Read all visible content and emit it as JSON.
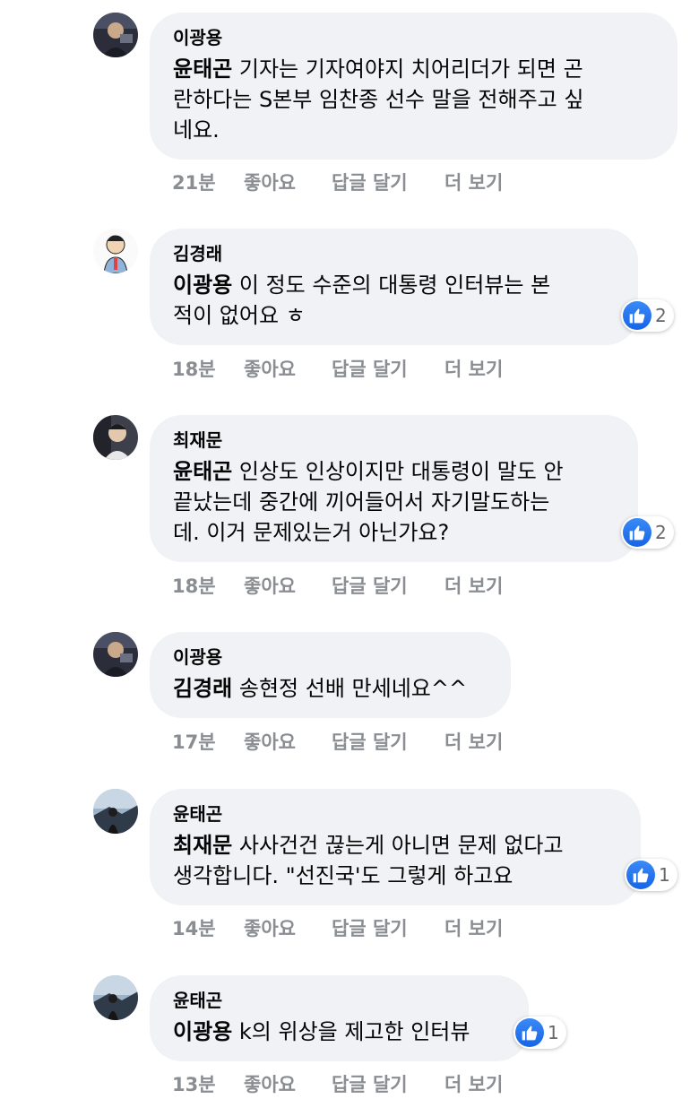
{
  "comments": [
    {
      "author": "이광용",
      "mention": "윤태곤",
      "text_lines": [
        " 기자는 기자여야지 치어리더가 되면 곤",
        "란하다는 S본부 임찬종 선수 말을 전해주고 싶",
        "네요."
      ],
      "time": "21분",
      "reactions": null
    },
    {
      "author": "김경래",
      "mention": "이광용",
      "text_lines": [
        " 이 정도 수준의 대통령 인터뷰는 본",
        "적이 없어요 ㅎ"
      ],
      "time": "18분",
      "reactions": "2"
    },
    {
      "author": "최재문",
      "mention": "윤태곤",
      "text_lines": [
        " 인상도 인상이지만 대통령이 말도 안",
        "끝났는데 중간에 끼어들어서 자기말도하는",
        "데. 이거 문제있는거 아닌가요?"
      ],
      "time": "18분",
      "reactions": "2"
    },
    {
      "author": "이광용",
      "mention": "김경래",
      "text_lines": [
        " 송현정 선배 만세네요^^"
      ],
      "time": "17분",
      "reactions": null
    },
    {
      "author": "윤태곤",
      "mention": "최재문",
      "text_lines": [
        " 사사건건 끊는게 아니면 문제 없다고",
        "생각합니다. \"선진국'도 그렇게 하고요"
      ],
      "time": "14분",
      "reactions": "1"
    },
    {
      "author": "윤태곤",
      "mention": "이광용",
      "text_lines": [
        " k의 위상을 제고한 인터뷰"
      ],
      "time": "13분",
      "reactions": "1"
    }
  ],
  "actions": {
    "like": "좋아요",
    "reply": "답글 달기",
    "more": "더 보기"
  },
  "colors": {
    "bubble": "#f0f2f5",
    "meta_text": "#8a8d91",
    "like_blue": "#1877f2"
  },
  "icons": {
    "like": "thumbs-up-icon",
    "avatar": "profile-photo"
  }
}
